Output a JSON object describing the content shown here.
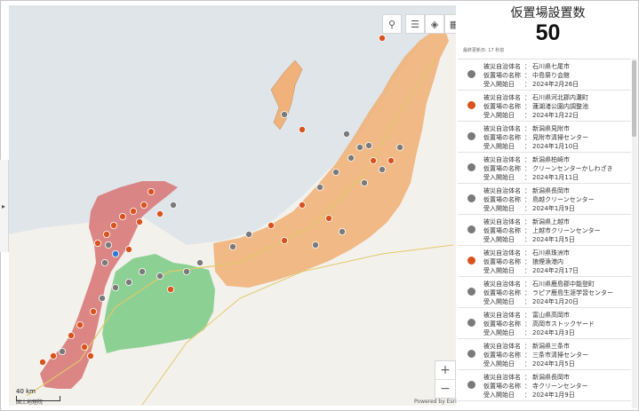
{
  "counter": {
    "title": "仮置場設置数",
    "value": "50",
    "updated": "最終更新日: 17 秒前"
  },
  "field_labels": {
    "municipality": "被災自治体名",
    "site": "仮置場の名称",
    "start": "受入開始日"
  },
  "colors": {
    "ishikawa_zone": "#d98080",
    "toyama_zone": "#86cf8e",
    "niigata_zone": "#f0b27a",
    "marker_open": "#d9531e",
    "marker_other": "#7a7a7a",
    "marker_blue": "#2f7ad1",
    "marker_green": "#4caf50"
  },
  "items": [
    {
      "municipality": "石川県七尾市",
      "site": "中島祭り会館",
      "start": "2024年2月26日",
      "icon": "gray"
    },
    {
      "municipality": "石川県河北郡内灘町",
      "site": "蓮湖渚公園内調整池",
      "start": "2024年1月22日",
      "icon": "orange"
    },
    {
      "municipality": "新潟県見附市",
      "site": "見附市清掃センター",
      "start": "2024年1月10日",
      "icon": "gray"
    },
    {
      "municipality": "新潟県柏崎市",
      "site": "クリーンセンターかしわざき",
      "start": "2024年1月11日",
      "icon": "gray"
    },
    {
      "municipality": "新潟県長岡市",
      "site": "鳥越クリーンセンター",
      "start": "2024年1月9日",
      "icon": "gray"
    },
    {
      "municipality": "新潟県上越市",
      "site": "上越市クリーンセンター",
      "start": "2024年1月5日",
      "icon": "gray"
    },
    {
      "municipality": "石川県珠洲市",
      "site": "狼煙漁港内",
      "start": "2024年2月17日",
      "icon": "orange"
    },
    {
      "municipality": "石川県鹿島郡中能登町",
      "site": "ラピア鹿島生涯学習センター",
      "start": "2024年1月20日",
      "icon": "gray"
    },
    {
      "municipality": "富山県高岡市",
      "site": "高岡市ストックヤード",
      "start": "2024年1月3日",
      "icon": "gray"
    },
    {
      "municipality": "新潟県三条市",
      "site": "三条市清掃センター",
      "start": "2024年1月5日",
      "icon": "gray"
    },
    {
      "municipality": "新潟県長岡市",
      "site": "寺クリーンセンター",
      "start": "2024年1月9日",
      "icon": "gray"
    }
  ],
  "map": {
    "scale_label": "40 km",
    "credit": "国土地理院",
    "esri": "Powered by Esri",
    "zoom_in": "+",
    "zoom_out": "−"
  },
  "toolbar": {
    "search": "⚲",
    "list": "☰",
    "layers": "◈",
    "grid": "▦"
  }
}
